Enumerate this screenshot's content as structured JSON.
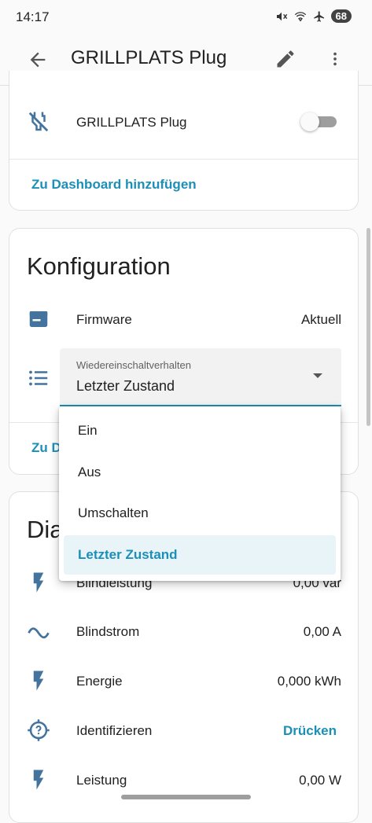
{
  "status_bar": {
    "time": "14:17",
    "battery": "68"
  },
  "app_bar": {
    "title": "GRILLPLATS Plug"
  },
  "device_card": {
    "entity_label": "GRILLPLATS Plug",
    "switch_state": "off",
    "dashboard_link": "Zu Dashboard hinzufügen"
  },
  "config_card": {
    "title": "Konfiguration",
    "firmware_label": "Firmware",
    "firmware_value": "Aktuell",
    "select_label": "Wiedereinschaltverhalten",
    "select_value": "Letzter Zustand",
    "dashboard_link_partial": "Zu D"
  },
  "dropdown": {
    "options": [
      "Ein",
      "Aus",
      "Umschalten",
      "Letzter Zustand"
    ],
    "selected": "Letzter Zustand"
  },
  "diagnostic_card": {
    "title_partial": "Dia",
    "rows": [
      {
        "label": "Blindleistung",
        "value": "0,00 var",
        "icon": "flash-icon"
      },
      {
        "label": "Blindstrom",
        "value": "0,00 A",
        "icon": "sine-wave-icon"
      },
      {
        "label": "Energie",
        "value": "0,000 kWh",
        "icon": "flash-icon"
      },
      {
        "label": "Identifizieren",
        "value": "Drücken",
        "icon": "help-target-icon"
      },
      {
        "label": "Leistung",
        "value": "0,00 W",
        "icon": "flash-icon"
      }
    ]
  },
  "colors": {
    "accent": "#1b8fb8",
    "icon_blue": "#44739e",
    "selected_bg": "#e9f4f8"
  }
}
